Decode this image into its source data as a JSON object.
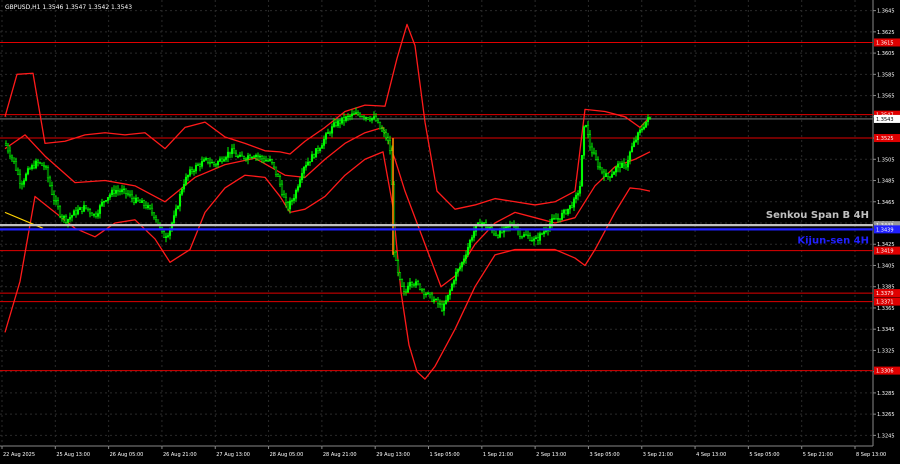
{
  "header": {
    "title": "GBPUSD,H1  1.3546 1.3547 1.3542 1.3543"
  },
  "chart_data": {
    "type": "candlestick",
    "symbol": "GBPUSD",
    "timeframe": "H1",
    "ohlc_readout": "1.3546 1.3547 1.3542 1.3543",
    "ylim": [
      1.3235,
      1.3655
    ],
    "y_ticks": [
      "1.3645",
      "1.3625",
      "1.3605",
      "1.3585",
      "1.3565",
      "1.3545",
      "1.3525",
      "1.3505",
      "1.3485",
      "1.3465",
      "1.3445",
      "1.3425",
      "1.3405",
      "1.3385",
      "1.3365",
      "1.3345",
      "1.3325",
      "1.3305",
      "1.3285",
      "1.3265",
      "1.3245"
    ],
    "x_ticks": [
      "22 Aug 2025",
      "25 Aug 13:00",
      "26 Aug 05:00",
      "26 Aug 21:00",
      "27 Aug 13:00",
      "28 Aug 05:00",
      "28 Aug 21:00",
      "29 Aug 13:00",
      "1 Sep 05:00",
      "1 Sep 21:00",
      "2 Sep 13:00",
      "3 Sep 05:00",
      "3 Sep 21:00",
      "4 Sep 13:00",
      "5 Sep 05:00",
      "5 Sep 21:00",
      "8 Sep 13:00"
    ],
    "current_price": 1.3543,
    "horizontal_levels": [
      {
        "value": 1.3615,
        "label": "1.3615",
        "color": "#e00000"
      },
      {
        "value": 1.3547,
        "label": "1.3547",
        "color": "#e00000"
      },
      {
        "value": 1.3525,
        "label": "1.3525",
        "color": "#e00000"
      },
      {
        "value": 1.3419,
        "label": "1.3419",
        "color": "#e00000"
      },
      {
        "value": 1.3379,
        "label": "1.3379",
        "color": "#e00000"
      },
      {
        "value": 1.3371,
        "label": "1.3371",
        "color": "#e00000"
      },
      {
        "value": 1.3306,
        "label": "1.3306",
        "color": "#e00000"
      }
    ],
    "indicator_lines": [
      {
        "name": "Senkou Span B 4H",
        "value": 1.3443,
        "label": "1.3443",
        "color": "#c0c0c0"
      },
      {
        "name": "Kijun-sen 4H",
        "value": 1.3439,
        "label": "1.3439",
        "color": "#2020ff"
      }
    ],
    "close_path": [
      [
        0,
        1.352
      ],
      [
        8,
        1.3505
      ],
      [
        16,
        1.3482
      ],
      [
        24,
        1.3495
      ],
      [
        32,
        1.3502
      ],
      [
        40,
        1.3498
      ],
      [
        48,
        1.347
      ],
      [
        56,
        1.3452
      ],
      [
        62,
        1.3448
      ],
      [
        70,
        1.3455
      ],
      [
        80,
        1.346
      ],
      [
        90,
        1.3452
      ],
      [
        100,
        1.3468
      ],
      [
        110,
        1.3476
      ],
      [
        120,
        1.3474
      ],
      [
        130,
        1.3466
      ],
      [
        140,
        1.3462
      ],
      [
        150,
        1.3452
      ],
      [
        158,
        1.3432
      ],
      [
        163,
        1.3436
      ],
      [
        170,
        1.3452
      ],
      [
        178,
        1.3482
      ],
      [
        186,
        1.3494
      ],
      [
        194,
        1.35
      ],
      [
        202,
        1.3504
      ],
      [
        210,
        1.35
      ],
      [
        218,
        1.3507
      ],
      [
        226,
        1.3513
      ],
      [
        234,
        1.3506
      ],
      [
        242,
        1.3508
      ],
      [
        250,
        1.351
      ],
      [
        258,
        1.3505
      ],
      [
        266,
        1.3503
      ],
      [
        274,
        1.3485
      ],
      [
        282,
        1.3458
      ],
      [
        290,
        1.3472
      ],
      [
        298,
        1.3498
      ],
      [
        306,
        1.3506
      ],
      [
        314,
        1.3516
      ],
      [
        322,
        1.3528
      ],
      [
        330,
        1.3538
      ],
      [
        338,
        1.3542
      ],
      [
        346,
        1.3546
      ],
      [
        354,
        1.3548
      ],
      [
        362,
        1.3545
      ],
      [
        370,
        1.3543
      ],
      [
        376,
        1.3532
      ],
      [
        382,
        1.3525
      ],
      [
        386,
        1.351
      ],
      [
        389,
        1.342
      ],
      [
        392,
        1.34
      ],
      [
        396,
        1.3386
      ],
      [
        400,
        1.3376
      ],
      [
        404,
        1.3392
      ],
      [
        410,
        1.3388
      ],
      [
        416,
        1.3384
      ],
      [
        424,
        1.3376
      ],
      [
        432,
        1.337
      ],
      [
        438,
        1.3364
      ],
      [
        444,
        1.3378
      ],
      [
        450,
        1.3396
      ],
      [
        456,
        1.3405
      ],
      [
        462,
        1.342
      ],
      [
        468,
        1.3436
      ],
      [
        476,
        1.3446
      ],
      [
        484,
        1.344
      ],
      [
        492,
        1.3434
      ],
      [
        500,
        1.3438
      ],
      [
        508,
        1.3445
      ],
      [
        516,
        1.3434
      ],
      [
        524,
        1.3432
      ],
      [
        530,
        1.3428
      ],
      [
        538,
        1.3436
      ],
      [
        546,
        1.3446
      ],
      [
        554,
        1.345
      ],
      [
        562,
        1.3457
      ],
      [
        570,
        1.3466
      ],
      [
        575,
        1.348
      ],
      [
        578,
        1.352
      ],
      [
        580,
        1.3546
      ],
      [
        584,
        1.352
      ],
      [
        590,
        1.3505
      ],
      [
        596,
        1.3495
      ],
      [
        602,
        1.3488
      ],
      [
        608,
        1.3493
      ],
      [
        614,
        1.35
      ],
      [
        620,
        1.3497
      ],
      [
        626,
        1.3514
      ],
      [
        632,
        1.3526
      ],
      [
        638,
        1.3536
      ],
      [
        642,
        1.3542
      ],
      [
        645,
        1.3543
      ]
    ],
    "bollinger_upper": [
      [
        0,
        1.3545
      ],
      [
        12,
        1.3585
      ],
      [
        28,
        1.3586
      ],
      [
        40,
        1.352
      ],
      [
        60,
        1.3522
      ],
      [
        80,
        1.3528
      ],
      [
        100,
        1.353
      ],
      [
        120,
        1.3528
      ],
      [
        140,
        1.353
      ],
      [
        160,
        1.3515
      ],
      [
        180,
        1.3535
      ],
      [
        200,
        1.354
      ],
      [
        220,
        1.3526
      ],
      [
        240,
        1.352
      ],
      [
        260,
        1.3513
      ],
      [
        275,
        1.3512
      ],
      [
        285,
        1.351
      ],
      [
        300,
        1.3522
      ],
      [
        320,
        1.3535
      ],
      [
        340,
        1.355
      ],
      [
        360,
        1.3556
      ],
      [
        380,
        1.3555
      ],
      [
        392,
        1.36
      ],
      [
        402,
        1.3632
      ],
      [
        410,
        1.3612
      ],
      [
        420,
        1.354
      ],
      [
        432,
        1.3475
      ],
      [
        450,
        1.3458
      ],
      [
        470,
        1.3462
      ],
      [
        490,
        1.3468
      ],
      [
        510,
        1.3465
      ],
      [
        530,
        1.3462
      ],
      [
        550,
        1.3465
      ],
      [
        570,
        1.3475
      ],
      [
        580,
        1.3552
      ],
      [
        600,
        1.355
      ],
      [
        620,
        1.3545
      ],
      [
        635,
        1.3535
      ],
      [
        645,
        1.3545
      ]
    ],
    "bollinger_middle": [
      [
        0,
        1.3515
      ],
      [
        20,
        1.3528
      ],
      [
        40,
        1.3508
      ],
      [
        70,
        1.3483
      ],
      [
        100,
        1.3485
      ],
      [
        130,
        1.348
      ],
      [
        160,
        1.3465
      ],
      [
        190,
        1.3488
      ],
      [
        220,
        1.35
      ],
      [
        250,
        1.3506
      ],
      [
        280,
        1.349
      ],
      [
        300,
        1.3488
      ],
      [
        320,
        1.3505
      ],
      [
        340,
        1.352
      ],
      [
        360,
        1.353
      ],
      [
        378,
        1.3535
      ],
      [
        390,
        1.3505
      ],
      [
        400,
        1.3475
      ],
      [
        420,
        1.3425
      ],
      [
        436,
        1.3385
      ],
      [
        450,
        1.3395
      ],
      [
        470,
        1.3425
      ],
      [
        490,
        1.3445
      ],
      [
        510,
        1.3455
      ],
      [
        530,
        1.345
      ],
      [
        550,
        1.3445
      ],
      [
        570,
        1.345
      ],
      [
        590,
        1.348
      ],
      [
        610,
        1.3498
      ],
      [
        630,
        1.3505
      ],
      [
        645,
        1.3512
      ]
    ],
    "bollinger_lower": [
      [
        0,
        1.3342
      ],
      [
        15,
        1.339
      ],
      [
        30,
        1.347
      ],
      [
        50,
        1.3455
      ],
      [
        70,
        1.344
      ],
      [
        90,
        1.3432
      ],
      [
        110,
        1.3445
      ],
      [
        130,
        1.3448
      ],
      [
        150,
        1.343
      ],
      [
        165,
        1.3408
      ],
      [
        185,
        1.342
      ],
      [
        200,
        1.3455
      ],
      [
        220,
        1.3478
      ],
      [
        240,
        1.349
      ],
      [
        260,
        1.3488
      ],
      [
        275,
        1.347
      ],
      [
        285,
        1.3455
      ],
      [
        300,
        1.3458
      ],
      [
        320,
        1.347
      ],
      [
        340,
        1.349
      ],
      [
        360,
        1.3505
      ],
      [
        378,
        1.3512
      ],
      [
        388,
        1.346
      ],
      [
        396,
        1.338
      ],
      [
        404,
        1.333
      ],
      [
        412,
        1.3305
      ],
      [
        420,
        1.3298
      ],
      [
        430,
        1.331
      ],
      [
        450,
        1.3345
      ],
      [
        470,
        1.3385
      ],
      [
        490,
        1.3415
      ],
      [
        510,
        1.342
      ],
      [
        530,
        1.342
      ],
      [
        550,
        1.342
      ],
      [
        570,
        1.3412
      ],
      [
        580,
        1.3405
      ],
      [
        590,
        1.342
      ],
      [
        610,
        1.3455
      ],
      [
        625,
        1.3478
      ],
      [
        635,
        1.3477
      ],
      [
        645,
        1.3475
      ]
    ],
    "yellow_segment": [
      [
        0,
        1.3455
      ],
      [
        38,
        1.344
      ]
    ]
  },
  "colors": {
    "background": "#000000",
    "grid": "#2a2a2a",
    "candles": "#00ff00",
    "bands": "#ff1a1a",
    "levels": "#e00000",
    "senkou": "#c0c0c0",
    "kijun": "#2020ff",
    "yellow": "#ffd200",
    "text": "#ffffff"
  }
}
